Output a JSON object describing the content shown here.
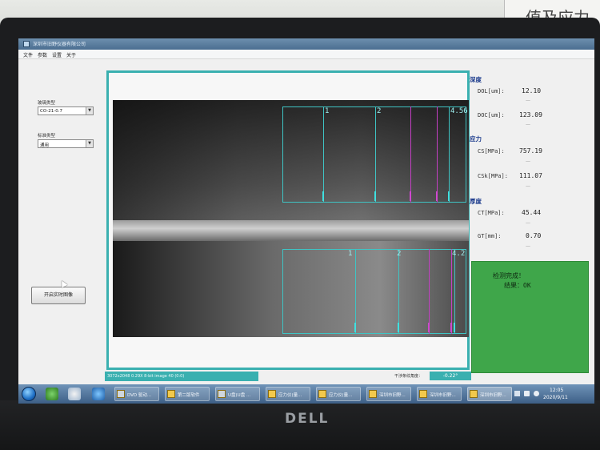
{
  "wall_sign": "值及应力",
  "monitor_brand": "DELL",
  "window": {
    "title": "深圳市旧野仪器有限公司"
  },
  "menu": [
    "文件",
    "参数",
    "设置",
    "关于"
  ],
  "left_panel": {
    "glass_type_label": "玻璃类型",
    "glass_type_value": "CO-21-0.7",
    "standard_type_label": "标准类型",
    "standard_type_value": "通用",
    "start_button": "开启实时图像"
  },
  "viewer": {
    "upper_markers": [
      "1",
      "2",
      "4.56"
    ],
    "lower_markers": [
      "1",
      "2",
      "4.2"
    ]
  },
  "status": {
    "image_info": "3072x2048 0.29X 8-bit image 40   (0:0)",
    "angle_label": "干涉条纹角度：",
    "angle_value": "-0.22°"
  },
  "results": {
    "depth_title": "深度",
    "dol_label": "DOL[um]:",
    "dol_value": "12.10",
    "doc_label": "DOC[um]:",
    "doc_value": "123.09",
    "stress_title": "应力",
    "cs_label": "CS[MPa]:",
    "cs_value": "757.19",
    "csk_label": "CSk[MPa]:",
    "csk_value": "111.07",
    "thickness_title": "厚度",
    "ct_label": "CT[MPa]:",
    "ct_value": "45.44",
    "gt_label": "GT[mm]:",
    "gt_value": "0.70",
    "dash": "—"
  },
  "verdict": {
    "line1": "检测完成！",
    "line2": "结果：OK",
    "color": "#3fa64a"
  },
  "taskbar": {
    "tasks": [
      "DVD 驱动...",
      "第二版软件",
      "U盘(U盘 ...",
      "应力仪(量...",
      "应力仪(量...",
      "深圳市旧野...",
      "深圳市旧野...",
      "深圳市旧野..."
    ],
    "time": "12:05",
    "date": "2020/9/11"
  }
}
